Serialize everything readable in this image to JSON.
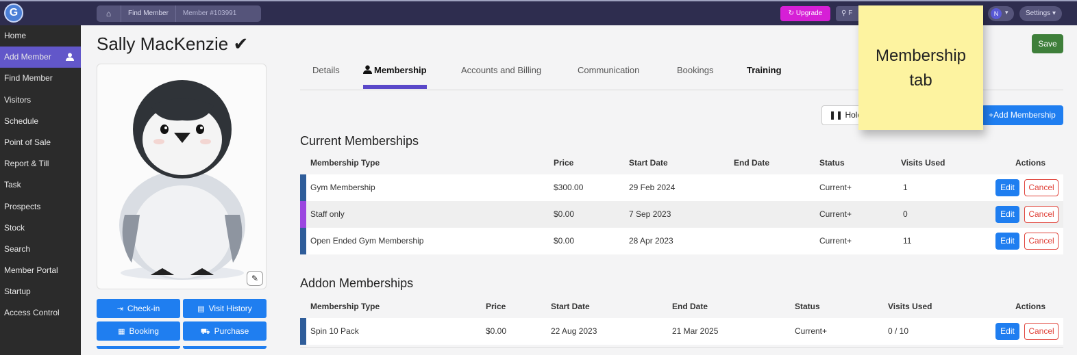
{
  "topbar": {
    "logo_letter": "G",
    "breadcrumb": {
      "home_icon": "home-icon",
      "items": [
        "Find Member",
        "Member #103991"
      ]
    },
    "upgrade_label": "Upgrade",
    "search_label": "F",
    "avatar_letter": "N",
    "settings_label": "Settings"
  },
  "sidebar": {
    "items": [
      {
        "label": "Home"
      },
      {
        "label": "Add Member",
        "active": true
      },
      {
        "label": "Find Member"
      },
      {
        "label": "Visitors"
      },
      {
        "label": "Schedule"
      },
      {
        "label": "Point of Sale"
      },
      {
        "label": "Report & Till"
      },
      {
        "label": "Task"
      },
      {
        "label": "Prospects"
      },
      {
        "label": "Stock"
      },
      {
        "label": "Search"
      },
      {
        "label": "Member Portal"
      },
      {
        "label": "Startup"
      },
      {
        "label": "Access Control"
      }
    ]
  },
  "member": {
    "name": "Sally MacKenzie",
    "verified_icon": "check-icon"
  },
  "save_label": "Save",
  "actions": {
    "checkin": "Check-in",
    "visit_history": "Visit History",
    "booking": "Booking",
    "purchase": "Purchase"
  },
  "tabs": [
    {
      "label": "Details"
    },
    {
      "label": "Membership",
      "active": true
    },
    {
      "label": "Accounts and Billing"
    },
    {
      "label": "Communication"
    },
    {
      "label": "Bookings"
    },
    {
      "label": "Training"
    }
  ],
  "hold_label": "Hold I",
  "add_membership_label": "Add Membership",
  "current": {
    "title": "Current Memberships",
    "headers": [
      "Membership Type",
      "Price",
      "Start Date",
      "End Date",
      "Status",
      "Visits Used",
      "Actions"
    ],
    "rows": [
      {
        "type": "Gym Membership",
        "price": "$300.00",
        "start": "29 Feb 2024",
        "end": "",
        "status": "Current+",
        "visits": "1",
        "stripe": "#2f5d9a"
      },
      {
        "type": "Staff only",
        "price": "$0.00",
        "start": "7 Sep 2023",
        "end": "",
        "status": "Current+",
        "visits": "0",
        "stripe": "#9b46e0"
      },
      {
        "type": "Open Ended Gym Membership",
        "price": "$0.00",
        "start": "28 Apr 2023",
        "end": "",
        "status": "Current+",
        "visits": "11",
        "stripe": "#2f5d9a"
      }
    ]
  },
  "addon": {
    "title": "Addon Memberships",
    "headers": [
      "Membership Type",
      "Price",
      "Start Date",
      "End Date",
      "Status",
      "Visits Used",
      "Actions"
    ],
    "rows": [
      {
        "type": "Spin 10 Pack",
        "price": "$0.00",
        "start": "22 Aug 2023",
        "end": "21 Mar 2025",
        "status": "Current+",
        "visits": "0 / 10",
        "stripe": "#2f5d9a"
      }
    ]
  },
  "row_actions": {
    "edit": "Edit",
    "cancel": "Cancel"
  },
  "sticky_note": {
    "line1": "Membership",
    "line2": "tab"
  }
}
